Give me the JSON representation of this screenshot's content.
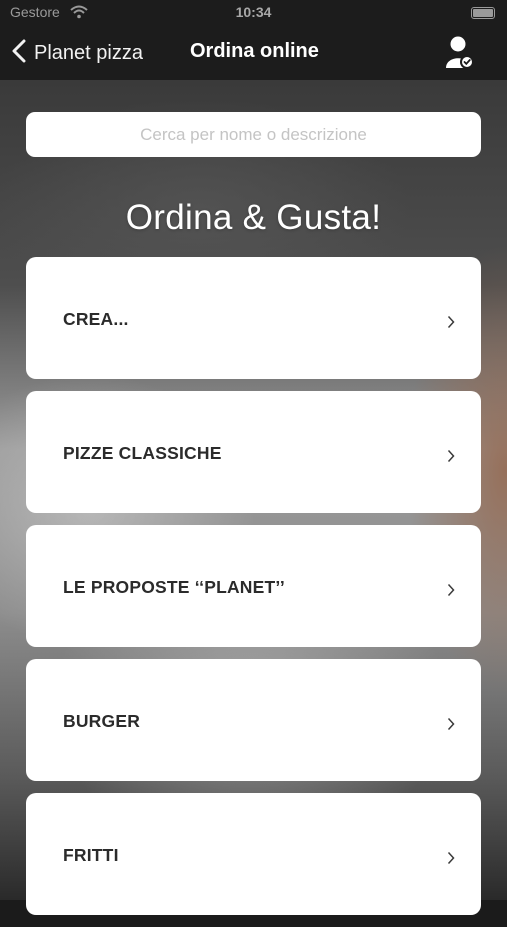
{
  "status_bar": {
    "carrier": "Gestore",
    "time": "10:34"
  },
  "nav": {
    "back_label": "Planet pizza",
    "title": "Ordina online"
  },
  "search": {
    "placeholder": "Cerca per nome o descrizione",
    "value": ""
  },
  "heading": "Ordina & Gusta!",
  "categories": [
    {
      "label": "CREA..."
    },
    {
      "label": "PIZZE CLASSICHE"
    },
    {
      "label": "LE PROPOSTE ‘‘PLANET’’"
    },
    {
      "label": "BURGER"
    },
    {
      "label": "FRITTI"
    }
  ],
  "icons": {
    "back": "chevron-left-icon",
    "user": "user-account-icon",
    "wifi": "wifi-icon",
    "battery": "battery-icon",
    "row": "chevron-right-icon"
  },
  "colors": {
    "nav_bg": "#1c1c1c",
    "card_bg": "#ffffff",
    "text": "#2b2b2b"
  }
}
